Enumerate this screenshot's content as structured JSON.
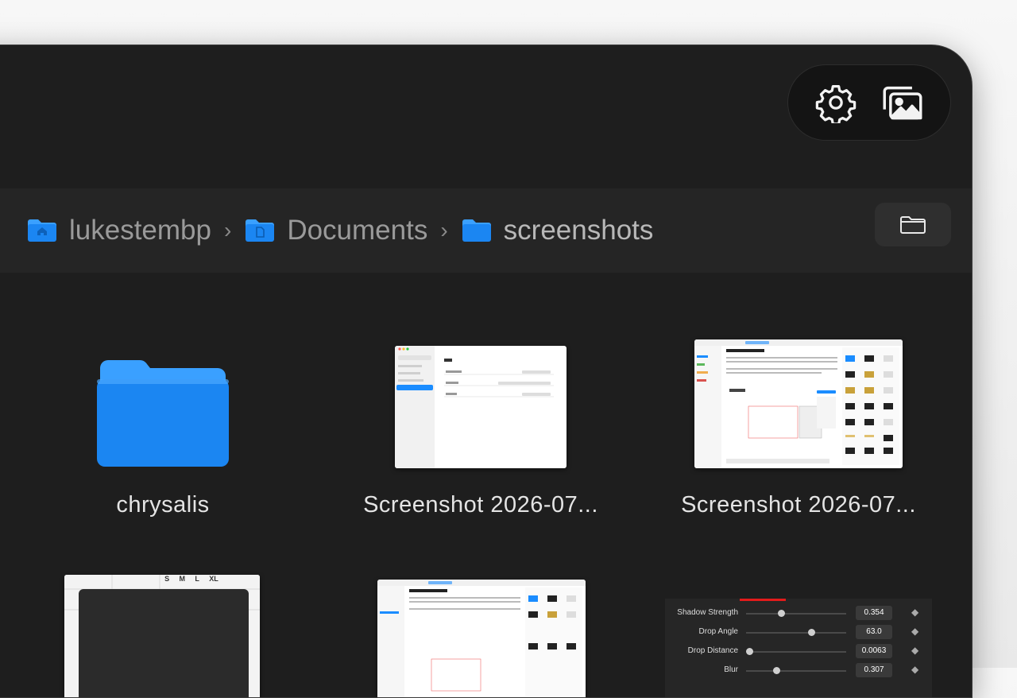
{
  "toolbar": {
    "settings_icon": "gear-icon",
    "gallery_icon": "photo-gallery-icon"
  },
  "breadcrumb": [
    {
      "label": "lukestembp",
      "icon": "home-folder-icon"
    },
    {
      "label": "Documents",
      "icon": "documents-folder-icon"
    },
    {
      "label": "screenshots",
      "icon": "folder-icon"
    }
  ],
  "breadcrumb_separator": "›",
  "open_folder_icon": "folder-outline-icon",
  "items": [
    {
      "name": "chrysalis",
      "kind": "folder"
    },
    {
      "name": "Screenshot 2026-07...",
      "kind": "image"
    },
    {
      "name": "Screenshot 2026-07...",
      "kind": "image"
    }
  ],
  "preview_panel": {
    "sliders": [
      {
        "label": "Shadow Strength",
        "value": "0.354",
        "level": 0.35
      },
      {
        "label": "Drop Angle",
        "value": "63.0",
        "level": 0.65
      },
      {
        "label": "Drop Distance",
        "value": "0.0063",
        "level": 0.03
      },
      {
        "label": "Blur",
        "value": "0.307",
        "level": 0.3
      }
    ],
    "size_options": [
      "S",
      "M",
      "L",
      "XL"
    ]
  },
  "colors": {
    "accent": "#1a8cff",
    "folder_top": "#3aa0ff",
    "folder_body": "#1b86f2",
    "window_bg": "#1e1e1e"
  }
}
